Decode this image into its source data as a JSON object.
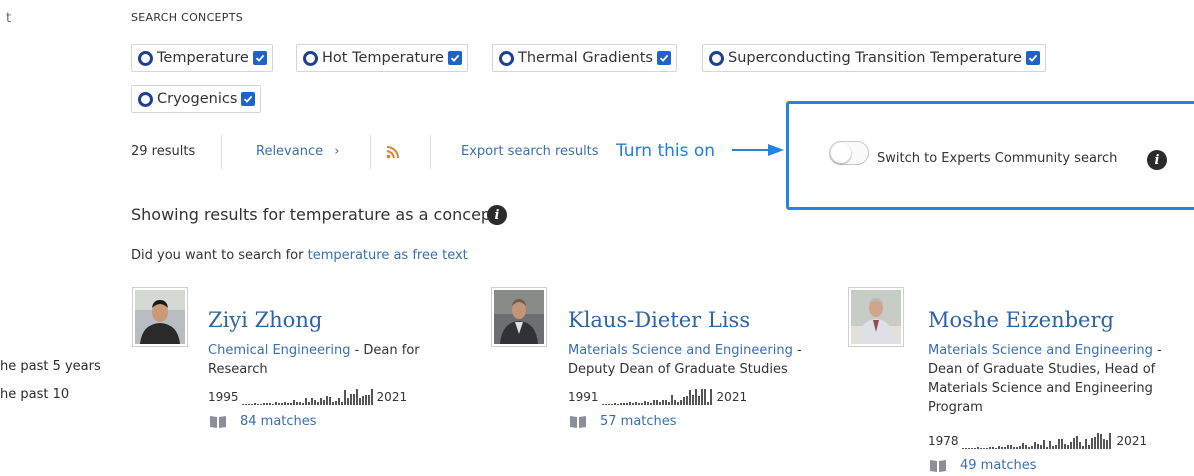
{
  "left_sidebar": {
    "top_fragment": "t",
    "filter_5": "he past 5 years",
    "filter_10": "he past 10"
  },
  "search_concepts": {
    "label": "SEARCH CONCEPTS",
    "chips": [
      {
        "label": "Temperature",
        "checked": true
      },
      {
        "label": "Hot Temperature",
        "checked": true
      },
      {
        "label": "Thermal Gradients",
        "checked": true
      },
      {
        "label": "Superconducting Transition Temperature",
        "checked": true
      },
      {
        "label": "Cryogenics",
        "checked": true
      }
    ]
  },
  "toolbar": {
    "results_count": "29 results",
    "sort_label": "Relevance",
    "sort_chevron": "›",
    "rss_icon": "rss-icon",
    "export_label": "Export search results"
  },
  "annotation": {
    "text": "Turn this on",
    "color": "#1f86e6"
  },
  "experts_toggle": {
    "label": "Switch to Experts Community search",
    "on": false
  },
  "results_info": {
    "showing": "Showing results for temperature as a concept",
    "did_you_prefix": "Did you want to search for ",
    "did_you_link": "temperature as free text"
  },
  "people": [
    {
      "name": "Ziyi Zhong",
      "dept": "Chemical Engineering",
      "role_sep": " - ",
      "role_line1": "Dean for",
      "role_rest": "Research",
      "year_start": "1995",
      "year_end": "2021",
      "matches": "84 matches"
    },
    {
      "name": "Klaus-Dieter Liss",
      "dept": "Materials Science and Engineering",
      "role_sep": " -",
      "role_rest": "Deputy Dean of Graduate Studies",
      "year_start": "1991",
      "year_end": "2021",
      "matches": "57 matches"
    },
    {
      "name": "Moshe Eizenberg",
      "dept": "Materials Science and Engineering",
      "role_sep": " -",
      "role_rest": "Dean of Graduate Studies, Head of Materials Science and Engineering Program",
      "year_start": "1978",
      "year_end": "2021",
      "matches": "49 matches"
    }
  ],
  "colors": {
    "link": "#3a6fb0",
    "name": "#2e63a8",
    "chip_ring": "#1f3f8f",
    "checkbox": "#1f62c8",
    "rss": "#e0802c"
  }
}
